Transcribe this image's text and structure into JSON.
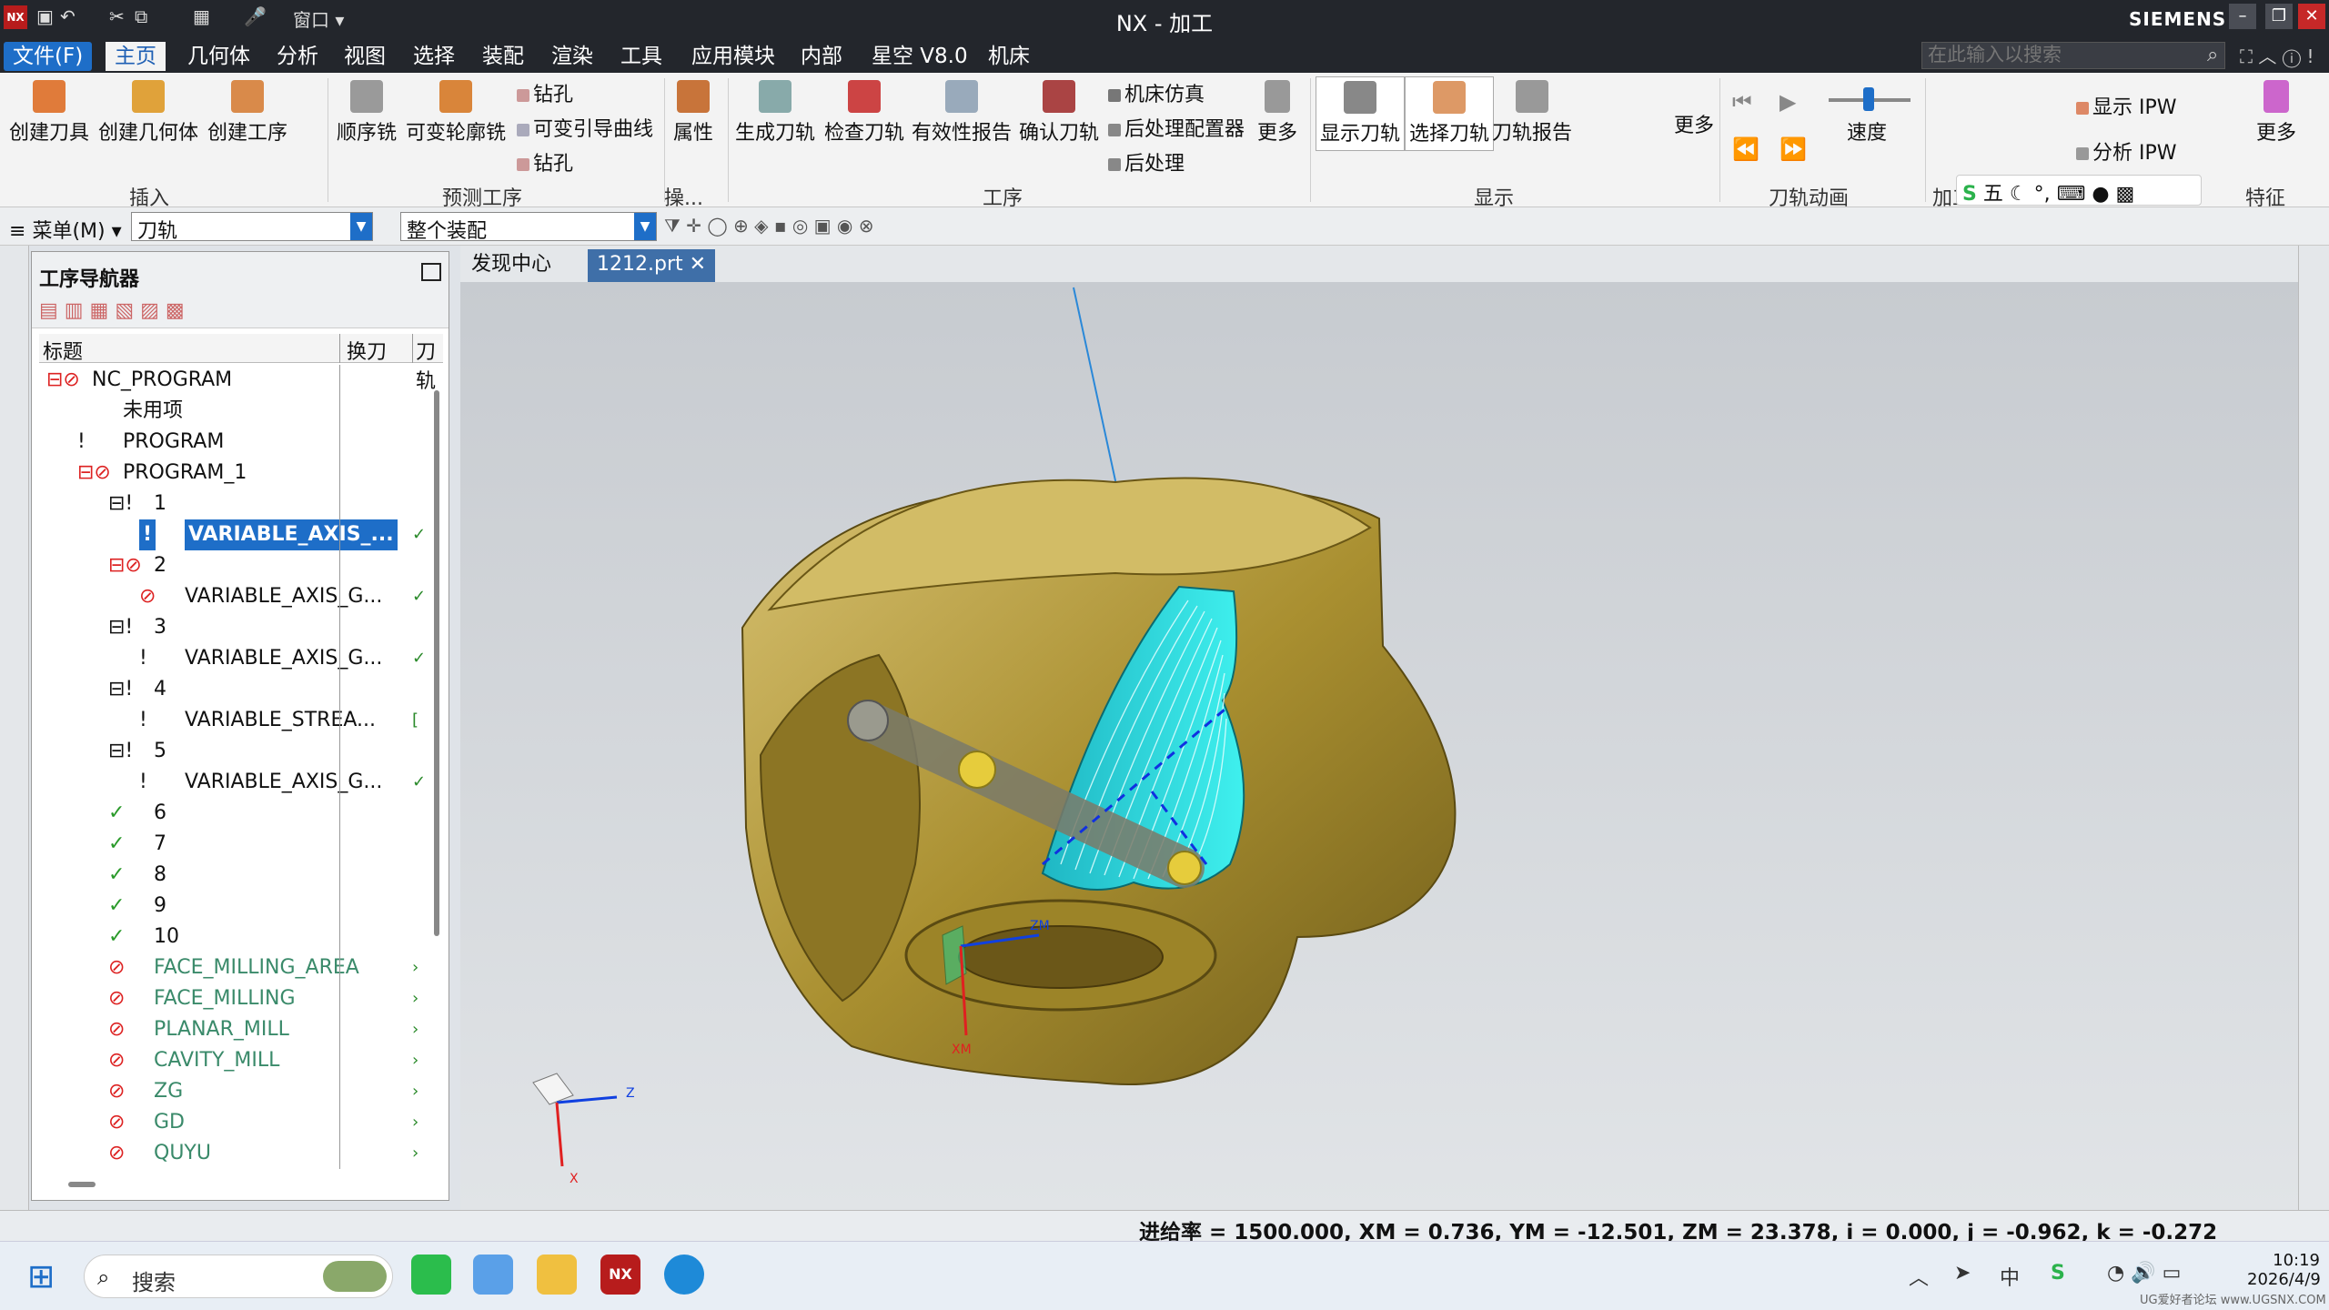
{
  "window": {
    "title": "NX - 加工",
    "brand": "SIEMENS",
    "app_logo": "NX",
    "window_menu": "窗口"
  },
  "menus": {
    "file": "文件(F)",
    "items": [
      "主页",
      "几何体",
      "分析",
      "视图",
      "选择",
      "装配",
      "渲染",
      "工具",
      "应用模块",
      "内部",
      "星空 V8.0",
      "机床"
    ],
    "search_placeholder": "在此输入以搜索"
  },
  "ribbon": {
    "insert": {
      "create_tool": "创建刀具",
      "create_geometry": "创建几何体",
      "create_operation": "创建工序",
      "group": "插入"
    },
    "preset": {
      "sequential_mill": "顺序铣",
      "variable_contour": "可变轮廓铣",
      "drill1": "钻孔",
      "variable_guide": "可变引导曲线",
      "drill2": "钻孔",
      "group": "预测工序"
    },
    "ops": {
      "attributes": "属性",
      "group": "操..."
    },
    "operation": {
      "generate": "生成刀轨",
      "verify": "检查刀轨",
      "validity_report": "有效性报告",
      "confirm": "确认刀轨",
      "machine_sim": "机床仿真",
      "post_config": "后处理配置器",
      "post": "后处理",
      "more": "更多",
      "group": "工序"
    },
    "display": {
      "show_path": "显示刀轨",
      "select_path": "选择刀轨",
      "path_report": "刀轨报告",
      "more": "更多",
      "group": "显示"
    },
    "animation": {
      "speed": "速度",
      "group": "刀轨动画"
    },
    "ipw": {
      "show_ipw": "显示 IPW",
      "analyze_ipw": "分析 IPW",
      "group": "加工"
    },
    "feature": {
      "more": "更多",
      "group": "特征"
    }
  },
  "toolbar2": {
    "menu": "菜单(M)",
    "filter": "刀轨",
    "scope": "整个装配"
  },
  "ime": {
    "mode": "五"
  },
  "navigator": {
    "title": "工序导航器",
    "col_title": "标题",
    "col_tool_change": "换刀",
    "col_path": "刀轨",
    "rows": [
      {
        "label": "NC_PROGRAM",
        "indent": 0,
        "mark": "⊟⊘"
      },
      {
        "label": "未用项",
        "indent": 1,
        "mark": ""
      },
      {
        "label": "PROGRAM",
        "indent": 1,
        "mark": "!"
      },
      {
        "label": "PROGRAM_1",
        "indent": 1,
        "mark": "⊟⊘"
      },
      {
        "label": "1",
        "indent": 2,
        "mark": "⊟!"
      },
      {
        "label": "VARIABLE_AXIS_...",
        "indent": 3,
        "mark": "!",
        "sel": true,
        "tail": "✓"
      },
      {
        "label": "2",
        "indent": 2,
        "mark": "⊟⊘"
      },
      {
        "label": "VARIABLE_AXIS_G...",
        "indent": 3,
        "mark": "⊘",
        "tail": "✓"
      },
      {
        "label": "3",
        "indent": 2,
        "mark": "⊟!"
      },
      {
        "label": "VARIABLE_AXIS_G...",
        "indent": 3,
        "mark": "!",
        "tail": "✓"
      },
      {
        "label": "4",
        "indent": 2,
        "mark": "⊟!"
      },
      {
        "label": "VARIABLE_STREA...",
        "indent": 3,
        "mark": "!",
        "tail": "["
      },
      {
        "label": "5",
        "indent": 2,
        "mark": "⊟!"
      },
      {
        "label": "VARIABLE_AXIS_G...",
        "indent": 3,
        "mark": "!",
        "tail": "✓"
      },
      {
        "label": "6",
        "indent": 2,
        "mark": "✓"
      },
      {
        "label": "7",
        "indent": 2,
        "mark": "✓"
      },
      {
        "label": "8",
        "indent": 2,
        "mark": "✓"
      },
      {
        "label": "9",
        "indent": 2,
        "mark": "✓"
      },
      {
        "label": "10",
        "indent": 2,
        "mark": "✓"
      },
      {
        "label": "FACE_MILLING_AREA",
        "indent": 2,
        "mark": "⊘",
        "gray": true,
        "tail": "›"
      },
      {
        "label": "FACE_MILLING",
        "indent": 2,
        "mark": "⊘",
        "gray": true,
        "tail": "›"
      },
      {
        "label": "PLANAR_MILL",
        "indent": 2,
        "mark": "⊘",
        "gray": true,
        "tail": "›"
      },
      {
        "label": "CAVITY_MILL",
        "indent": 2,
        "mark": "⊘",
        "gray": true,
        "tail": "›"
      },
      {
        "label": "ZG",
        "indent": 2,
        "mark": "⊘",
        "gray": true,
        "tail": "›"
      },
      {
        "label": "GD",
        "indent": 2,
        "mark": "⊘",
        "gray": true,
        "tail": "›"
      },
      {
        "label": "QUYU",
        "indent": 2,
        "mark": "⊘",
        "gray": true,
        "tail": "›"
      }
    ]
  },
  "doc_tabs": {
    "discovery": "发现中心",
    "file": "1212.prt"
  },
  "viewport": {
    "axis_zm": "ZM",
    "axis_xm": "XM",
    "triad_z": "Z",
    "triad_x": "X"
  },
  "status": {
    "text": "进给率 = 1500.000, XM = 0.736, YM = -12.501, ZM = 23.378, i = 0.000, j = -0.962, k = -0.272"
  },
  "taskbar": {
    "search": "搜索",
    "time": "10:19",
    "date": "2026/4/9",
    "ime_lang": "中",
    "watermark": "UG爱好者论坛 www.UGSNX.COM"
  },
  "colors": {
    "accent": "#1e6ec8",
    "part": "#b49a38",
    "toolpath": "#27e0e0"
  }
}
